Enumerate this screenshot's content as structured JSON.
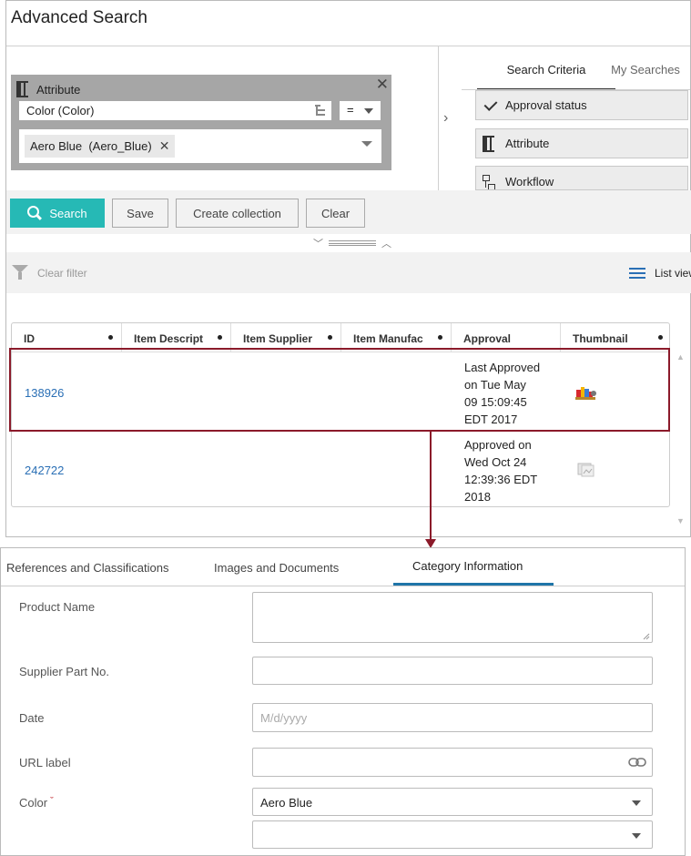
{
  "window": {
    "title": "Advanced Search"
  },
  "attribute_criterion": {
    "header": "Attribute",
    "field": "Color (Color)",
    "operator": "=",
    "value_chip": "Aero Blue  (Aero_Blue)"
  },
  "criteria_tabs": [
    "Search Criteria",
    "My Searches"
  ],
  "criteria_buttons": [
    "Approval status",
    "Attribute",
    "Workflow"
  ],
  "actions": {
    "search": "Search",
    "save": "Save",
    "create_collection": "Create collection",
    "clear": "Clear"
  },
  "filter_bar": {
    "clear_filter": "Clear filter",
    "list_view": "List view"
  },
  "table": {
    "columns": [
      "ID",
      "Item Descript",
      "Item Supplier",
      "Item Manufac",
      "Approval",
      "Thumbnail"
    ],
    "rows": [
      {
        "id": "138926",
        "approval_lines": [
          "Last Approved",
          "on Tue May",
          "09 15:09:45",
          "EDT 2017"
        ]
      },
      {
        "id": "242722",
        "approval_lines": [
          "Approved on",
          "Wed Oct 24",
          "12:39:36 EDT",
          "2018"
        ]
      }
    ]
  },
  "detail_tabs": [
    "References and Classifications",
    "Images and Documents",
    "Category Information"
  ],
  "form": {
    "product_name_label": "Product Name",
    "supplier_part_label": "Supplier Part No.",
    "date_label": "Date",
    "date_placeholder": "M/d/yyyy",
    "url_label": "URL label",
    "color_label": "Color",
    "color_value": "Aero Blue",
    "color_value_2": ""
  },
  "colors": {
    "accent_teal": "#26b9b5",
    "link_blue": "#2a6fb5",
    "highlight": "#8b1a2a",
    "tab_blue": "#1f75a8"
  }
}
